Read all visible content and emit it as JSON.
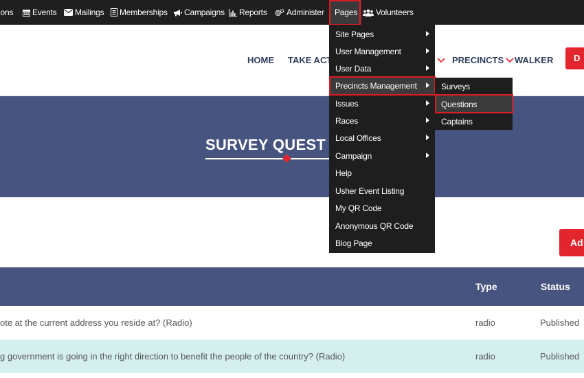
{
  "admin_bar": {
    "items": [
      {
        "label": "ions",
        "icon": "none"
      },
      {
        "label": "Events",
        "icon": "calendar-icon"
      },
      {
        "label": "Mailings",
        "icon": "envelope-icon"
      },
      {
        "label": "Memberships",
        "icon": "id-card-icon"
      },
      {
        "label": "Campaigns",
        "icon": "megaphone-icon"
      },
      {
        "label": "Reports",
        "icon": "chart-icon"
      },
      {
        "label": "Administer",
        "icon": "gears-icon"
      },
      {
        "label": "Pages",
        "icon": "none"
      },
      {
        "label": "Volunteers",
        "icon": "users-icon"
      }
    ]
  },
  "nav": {
    "home": "HOME",
    "take_action": "TAKE ACTI",
    "precincts": "PRECINCTS",
    "walker": "WALKER",
    "donate": "D"
  },
  "hero": {
    "title": "SURVEY QUEST"
  },
  "content": {
    "add_button": "Ad"
  },
  "table": {
    "columns": {
      "type": "Type",
      "status": "Status"
    },
    "rows": [
      {
        "question": "ote at the current address you reside at? (Radio)",
        "type": "radio",
        "status": "Published"
      },
      {
        "question": "g government is going in the right direction to benefit the people of the country? (Radio)",
        "type": "radio",
        "status": "Published"
      }
    ]
  },
  "pages_menu": {
    "items": [
      {
        "label": "Site Pages",
        "submenu": true
      },
      {
        "label": "User Management",
        "submenu": true
      },
      {
        "label": "User Data",
        "submenu": true
      },
      {
        "label": "Precincts Management",
        "submenu": true
      },
      {
        "label": "Issues",
        "submenu": true
      },
      {
        "label": "Races",
        "submenu": true
      },
      {
        "label": "Local Offices",
        "submenu": true
      },
      {
        "label": "Campaign",
        "submenu": true
      },
      {
        "label": "Help",
        "submenu": false
      },
      {
        "label": "Usher Event Listing",
        "submenu": false
      },
      {
        "label": "My QR Code",
        "submenu": false
      },
      {
        "label": "Anonymous QR Code",
        "submenu": false
      },
      {
        "label": "Blog Page",
        "submenu": false
      }
    ]
  },
  "precincts_submenu": {
    "items": [
      {
        "label": "Surveys"
      },
      {
        "label": "Questions"
      },
      {
        "label": "Captains"
      }
    ]
  },
  "colors": {
    "admin_bar": "#1f1f1f",
    "navy": "#485480",
    "accent_red": "#e3262d",
    "highlight_red": "#e01b24",
    "row_alt": "#d5efef"
  }
}
